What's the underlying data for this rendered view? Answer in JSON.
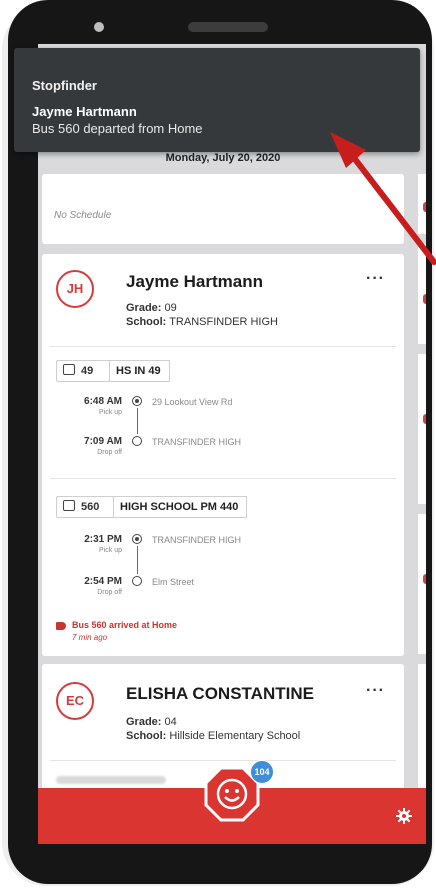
{
  "notification": {
    "app": "Stopfinder",
    "title": "Jayme Hartmann",
    "body": "Bus 560 departed from Home"
  },
  "date": "Monday, July 20, 2020",
  "no_schedule": "No Schedule",
  "students": [
    {
      "initials": "JH",
      "name": "Jayme Hartmann",
      "grade_label": "Grade:",
      "grade": "09",
      "school_label": "School:",
      "school": "TRANSFINDER HIGH",
      "more": "···",
      "trips": [
        {
          "bus": "49",
          "route": "HS IN 49",
          "stops": [
            {
              "time": "6:48 AM",
              "type": "Pick up",
              "place": "29 Lookout View Rd"
            },
            {
              "time": "7:09 AM",
              "type": "Drop off",
              "place": "TRANSFINDER HIGH"
            }
          ]
        },
        {
          "bus": "560",
          "route": "HIGH SCHOOL PM 440",
          "stops": [
            {
              "time": "2:31 PM",
              "type": "Pick up",
              "place": "TRANSFINDER HIGH"
            },
            {
              "time": "2:54 PM",
              "type": "Drop off",
              "place": "Elm Street"
            }
          ]
        }
      ],
      "alert": "Bus 560 arrived at Home",
      "alert_time": "7 min ago"
    },
    {
      "initials": "EC",
      "name": "ELISHA CONSTANTINE",
      "grade_label": "Grade:",
      "grade": "04",
      "school_label": "School:",
      "school": "Hillside Elementary School",
      "more": "···"
    }
  ],
  "badge_count": "104",
  "colors": {
    "accent": "#da3530",
    "notification_bg": "#35393c",
    "badge": "#3e8ed9",
    "screen_bg": "#dadadd"
  },
  "icons": [
    "bus-icon",
    "stop-sign-smiley-icon",
    "gear-icon",
    "alert-bell-icon",
    "red-pointer-arrow"
  ]
}
